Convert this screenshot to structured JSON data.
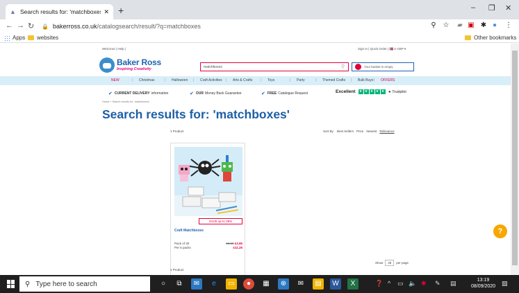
{
  "browser": {
    "tab_title": "Search results for: 'matchboxes'",
    "tab_close": "✕",
    "new_tab": "+",
    "url_host": "bakerross.co.uk",
    "url_path": "/catalogsearch/result/?q=matchboxes",
    "bookmarks": {
      "apps": "Apps",
      "websites": "websites",
      "other": "Other bookmarks"
    },
    "window_controls": {
      "minimize": "–",
      "maximize": "❐",
      "close": "✕"
    }
  },
  "site": {
    "top_links_left": "Welcome  |  Help  |",
    "top_links_right": "Sign In  |  Quick Order  |  🇬🇧 £ GBP ▾",
    "brand": "Baker Ross",
    "tagline": "Inspiring Creativity",
    "search_value": "matchboxes",
    "basket_text": "Your basket is empty",
    "categories": [
      {
        "label": "NEW",
        "red": true
      },
      {
        "label": "Christmas",
        "red": false
      },
      {
        "label": "Halloween",
        "red": false
      },
      {
        "label": "Craft Activities",
        "red": false
      },
      {
        "label": "Arts & Crafts",
        "red": false
      },
      {
        "label": "Toys",
        "red": false
      },
      {
        "label": "Party",
        "red": false
      },
      {
        "label": "Themed Crafts",
        "red": false
      },
      {
        "label": "Bulk Buys",
        "red": false
      },
      {
        "label": "OFFERS",
        "red": true
      }
    ],
    "usp": [
      {
        "bold": "CURRENT DELIVERY",
        "rest": "information"
      },
      {
        "bold": "OUR",
        "rest": "Money Back Guarantee"
      },
      {
        "bold": "FREE",
        "rest": "Catalogue Request"
      }
    ],
    "trustpilot": {
      "label": "Excellent",
      "brand": "★ Trustpilot"
    },
    "breadcrumb": "Home  >  Search results for: 'matchboxes'",
    "heading": "Search results for: 'matchboxes'",
    "product_count": "1 Product",
    "sort": {
      "label": "Sort By",
      "options": [
        "Best Sellers",
        "Price",
        "Newest",
        "Relevance"
      ],
      "active": "Relevance"
    },
    "product": {
      "save_text": "SAVE up to 28%",
      "name": "Craft Matchboxes",
      "pack": "Pack of 30",
      "per": "Per 5 packs",
      "old_price": "£5.50",
      "new_price": "£3.95",
      "pack_price": "£11.25"
    },
    "show": {
      "label": "Show",
      "value": "48",
      "suffix": "per page"
    },
    "help": "?"
  },
  "taskbar": {
    "search_placeholder": "Type here to search",
    "time": "13:19",
    "date": "08/09/2020"
  }
}
